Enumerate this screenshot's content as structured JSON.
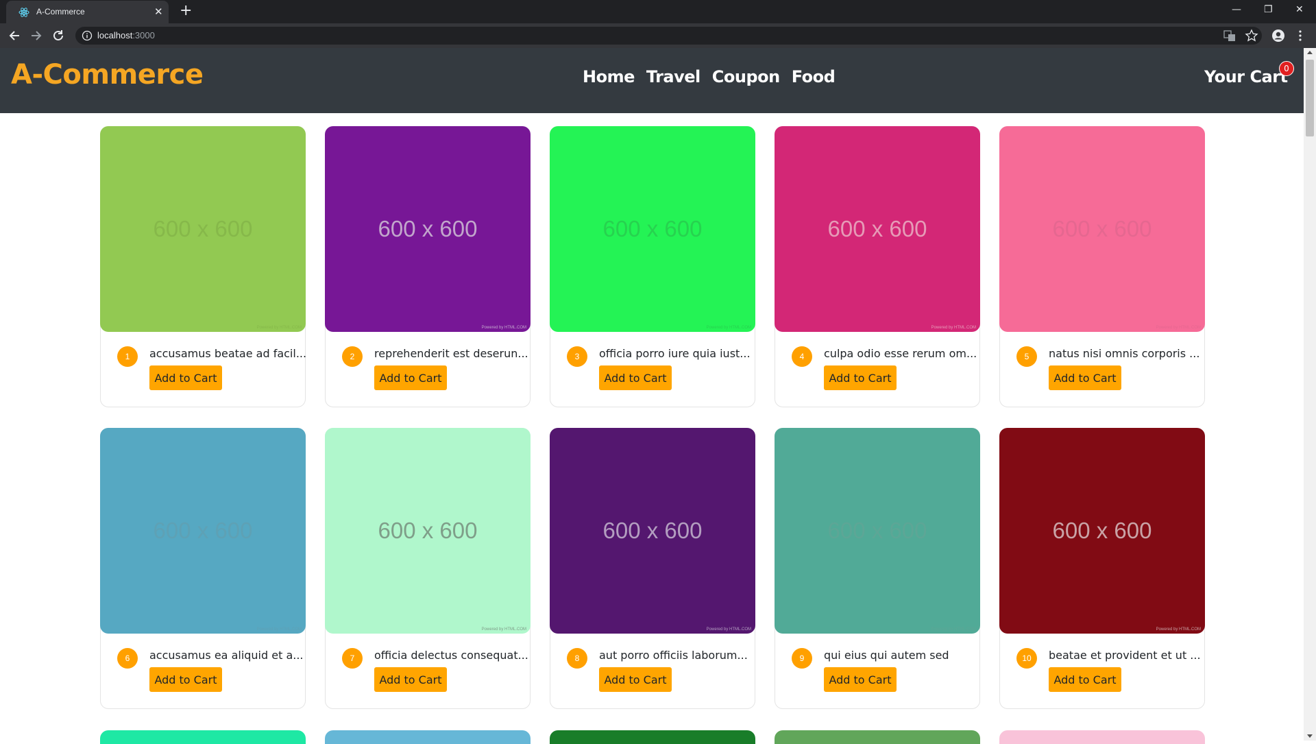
{
  "browser": {
    "tab_title": "A-Commerce",
    "url_host": "localhost",
    "url_port": ":3000"
  },
  "header": {
    "brand": "A-Commerce",
    "nav": [
      "Home",
      "Travel",
      "Coupon",
      "Food"
    ],
    "cart_label": "Your Cart",
    "cart_count": "0"
  },
  "products": [
    {
      "num": "1",
      "title": "accusamus beatae ad facil...",
      "button": "Add to Cart",
      "bg": "#92c952",
      "fg": "#86b84a",
      "img_text": "600 x 600"
    },
    {
      "num": "2",
      "title": "reprehenderit est deserun...",
      "button": "Add to Cart",
      "bg": "#771796",
      "fg": "#c2a6cc",
      "img_text": "600 x 600"
    },
    {
      "num": "3",
      "title": "officia porro iure quia iust...",
      "button": "Add to Cart",
      "bg": "#24f355",
      "fg": "#27d24f",
      "img_text": "600 x 600"
    },
    {
      "num": "4",
      "title": "culpa odio esse rerum om...",
      "button": "Add to Cart",
      "bg": "#d32776",
      "fg": "#e69bb7",
      "img_text": "600 x 600"
    },
    {
      "num": "5",
      "title": "natus nisi omnis corporis ...",
      "button": "Add to Cart",
      "bg": "#f66b97",
      "fg": "#e56790",
      "img_text": "600 x 600"
    },
    {
      "num": "6",
      "title": "accusamus ea aliquid et a...",
      "button": "Add to Cart",
      "bg": "#56a8c2",
      "fg": "#5ea1b5",
      "img_text": "600 x 600"
    },
    {
      "num": "7",
      "title": "officia delectus consequat...",
      "button": "Add to Cart",
      "bg": "#b0f7cc",
      "fg": "#7f9e89",
      "img_text": "600 x 600"
    },
    {
      "num": "8",
      "title": "aut porro officiis laborum...",
      "button": "Add to Cart",
      "bg": "#54176f",
      "fg": "#b39ec0",
      "img_text": "600 x 600"
    },
    {
      "num": "9",
      "title": "qui eius qui autem sed",
      "button": "Add to Cart",
      "bg": "#51aa97",
      "fg": "#5da696",
      "img_text": "600 x 600"
    },
    {
      "num": "10",
      "title": "beatae et provident et ut ...",
      "button": "Add to Cart",
      "bg": "#810b14",
      "fg": "#c9a3a6",
      "img_text": "600 x 600"
    }
  ],
  "partial_row_colors": [
    "#1ee8a4",
    "#66b7d7",
    "#197d29",
    "#61a65a",
    "#f9c3d9"
  ],
  "img_footer": "Powered by HTML.COM"
}
